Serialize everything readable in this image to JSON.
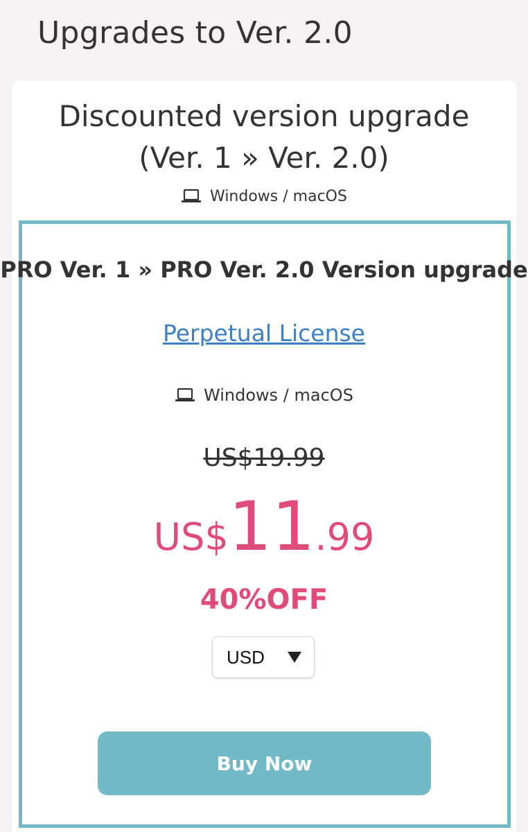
{
  "page": {
    "title": "Upgrades to Ver. 2.0"
  },
  "card": {
    "title_line1": "Discounted version upgrade",
    "title_line2": "(Ver. 1 » Ver. 2.0)",
    "platforms": "Windows / macOS",
    "platform_icon": "laptop-icon"
  },
  "offer": {
    "title": "PRO Ver. 1 » PRO Ver. 2.0 Version upgrade",
    "license_link": "Perpetual License",
    "platforms": "Windows / macOS",
    "platform_icon": "laptop-icon",
    "original_price": "US$19.99",
    "price_currency": "US$",
    "price_integer": "11",
    "price_decimal": ".99",
    "discount": "40%OFF",
    "currency_selected": "USD",
    "buy_label": "Buy Now"
  },
  "colors": {
    "accent_teal": "#6fb8c5",
    "price_pink": "#df4c7a",
    "link_blue": "#3c7fc4",
    "page_bg": "#f4f2f3"
  }
}
